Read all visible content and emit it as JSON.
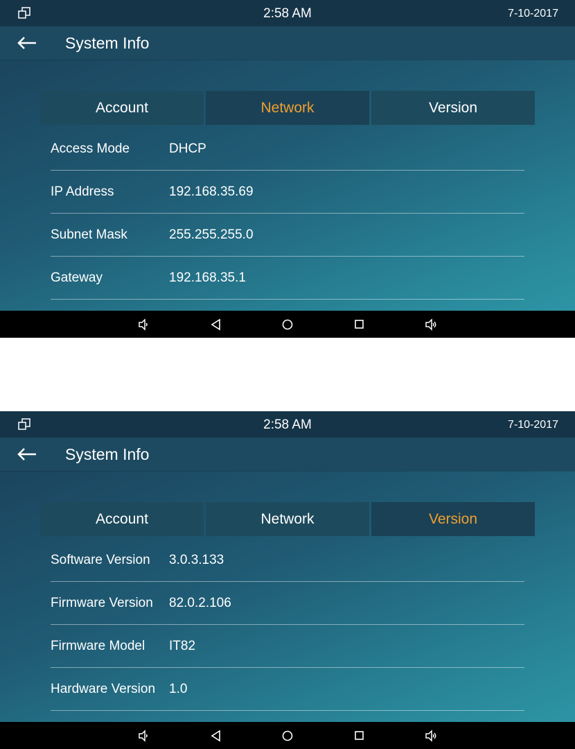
{
  "screens": [
    {
      "status": {
        "time": "2:58 AM",
        "date": "7-10-2017"
      },
      "header": {
        "title": "System Info"
      },
      "tabs": [
        {
          "label": "Account",
          "active": false
        },
        {
          "label": "Network",
          "active": true
        },
        {
          "label": "Version",
          "active": false
        }
      ],
      "rows": [
        {
          "label": "Access Mode",
          "value": "DHCP"
        },
        {
          "label": "IP Address",
          "value": "192.168.35.69"
        },
        {
          "label": "Subnet Mask",
          "value": "255.255.255.0"
        },
        {
          "label": "Gateway",
          "value": "192.168.35.1"
        }
      ]
    },
    {
      "status": {
        "time": "2:58 AM",
        "date": "7-10-2017"
      },
      "header": {
        "title": "System Info"
      },
      "tabs": [
        {
          "label": "Account",
          "active": false
        },
        {
          "label": "Network",
          "active": false
        },
        {
          "label": "Version",
          "active": true
        }
      ],
      "rows": [
        {
          "label": "Software Version",
          "value": "3.0.3.133"
        },
        {
          "label": "Firmware Version",
          "value": "82.0.2.106"
        },
        {
          "label": "Firmware Model",
          "value": "IT82"
        },
        {
          "label": "Hardware Version",
          "value": "1.0"
        }
      ]
    }
  ],
  "icons": {
    "window": "window-restore-icon",
    "back": "back-arrow-icon",
    "nav": [
      "volume-down-icon",
      "back-triangle-icon",
      "home-circle-icon",
      "recents-square-icon",
      "volume-up-icon"
    ]
  },
  "colors": {
    "active_tab": "#f0a030",
    "status_bar": "#153447",
    "app_bar": "#1d4a60",
    "tab_bg": "#1e4a5e",
    "nav_bar": "#000000"
  }
}
